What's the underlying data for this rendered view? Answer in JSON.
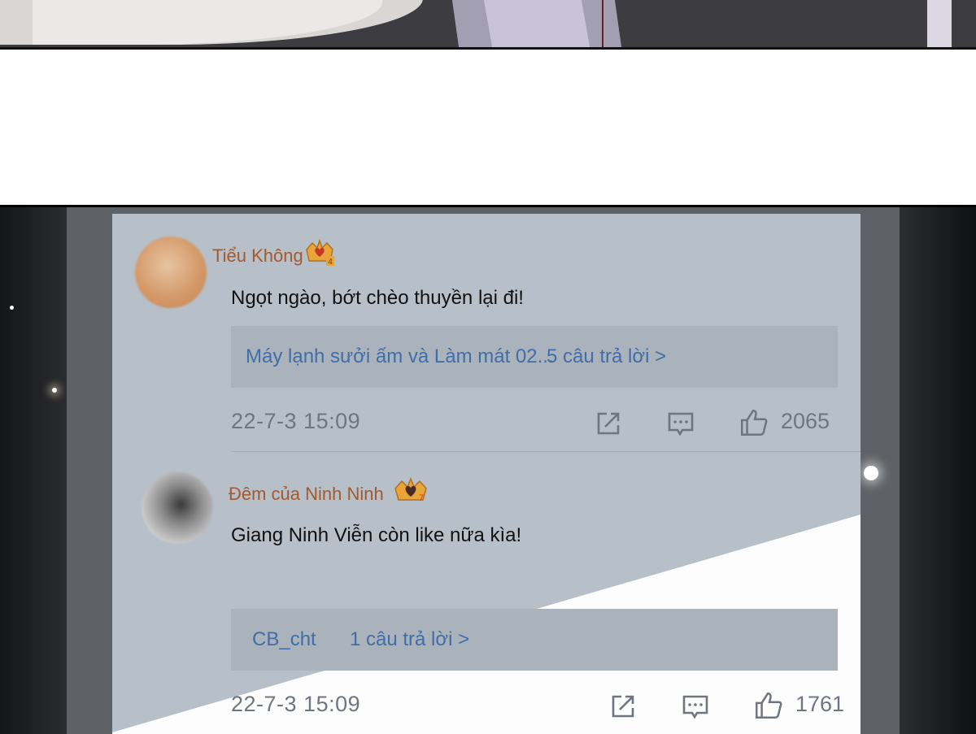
{
  "comments": [
    {
      "username": "Tiểu Không",
      "badge_icon": "crown-heart-badge-icon",
      "badge_level": "4",
      "text": "Ngọt ngào, bớt chèo thuyền lại đi!",
      "reply_preview_name": "Máy lạnh sưởi ấm và Làm mát 02...",
      "reply_count_label": "5 câu trả lời >",
      "timestamp": "22-7-3 15:09",
      "likes": "2065",
      "avatar_color": "#d49a6a"
    },
    {
      "username": "Đêm của Ninh Ninh",
      "badge_icon": "crown-heart-badge-icon",
      "badge_level": "7",
      "text": "Giang Ninh Viễn còn like nữa kìa!",
      "reply_preview_name": "CB_cht",
      "reply_count_label": "1 câu trả lời >",
      "timestamp": "22-7-3 15:09",
      "likes": "1761",
      "avatar_color": "#8a8a8a"
    }
  ],
  "icons": [
    "share-icon",
    "comment-icon",
    "thumbs-up-icon"
  ],
  "colors": {
    "username": "#a35a2e",
    "reply_link": "#3f6ea8",
    "card_bg": "#b7bfc8",
    "meta_text": "#6f7680"
  }
}
